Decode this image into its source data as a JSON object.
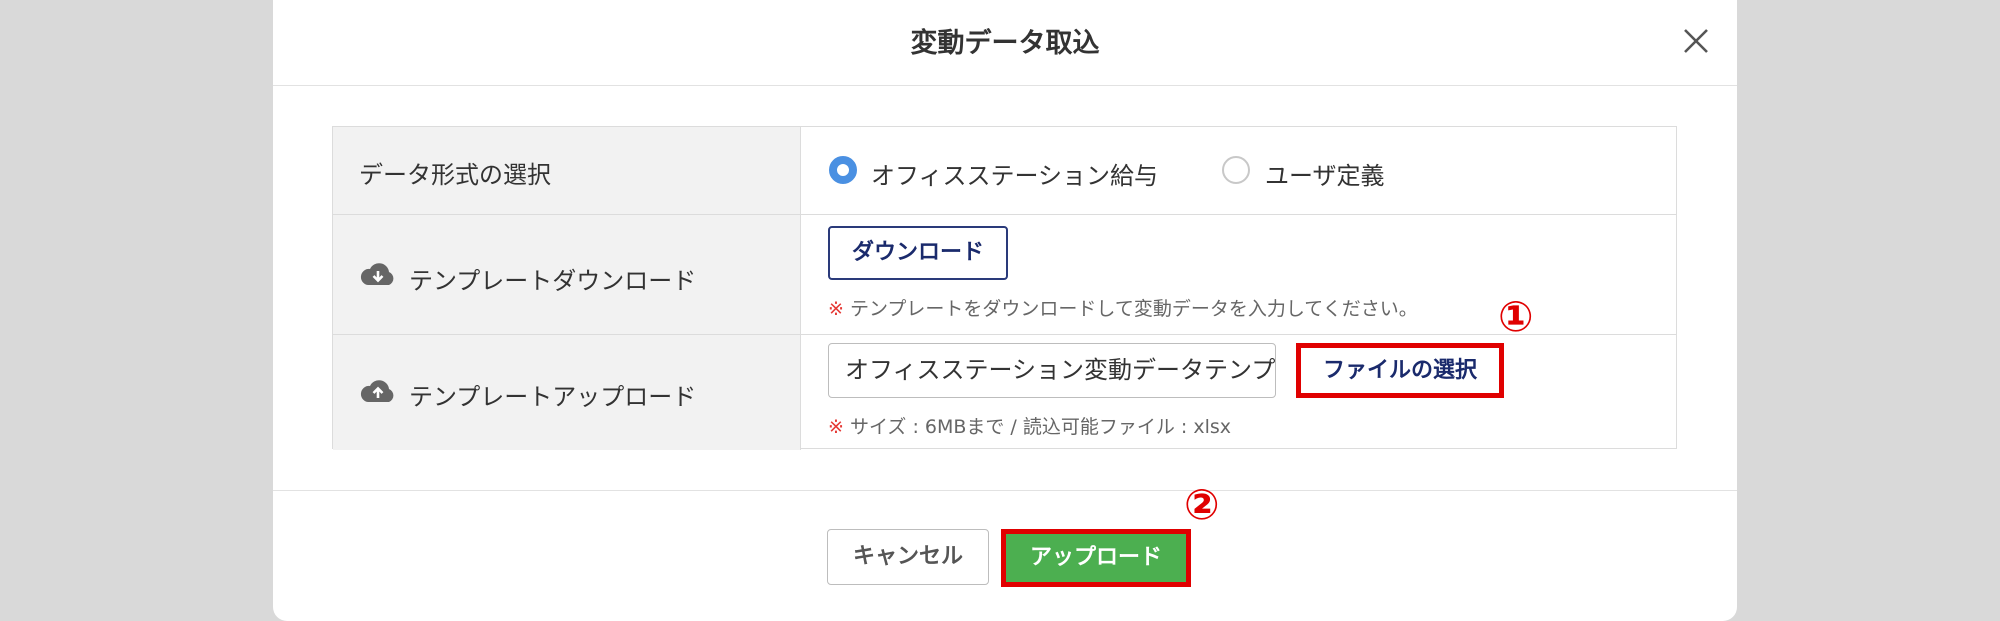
{
  "dialog": {
    "title": "変動データ取込"
  },
  "rows": {
    "format": {
      "label": "データ形式の選択",
      "options": [
        {
          "label": "オフィスステーション給与",
          "checked": true
        },
        {
          "label": "ユーザ定義",
          "checked": false
        }
      ]
    },
    "download": {
      "label": "テンプレートダウンロード",
      "button": "ダウンロード",
      "note_mark": "※",
      "note": "テンプレートをダウンロードして変動データを入力してください。"
    },
    "upload": {
      "label": "テンプレートアップロード",
      "file_value": "オフィスステーション変動データテンプレート",
      "file_button": "ファイルの選択",
      "note_mark": "※",
      "note": "サイズ : 6MBまで / 読込可能ファイル : xlsx"
    }
  },
  "footer": {
    "cancel": "キャンセル",
    "upload": "アップロード"
  },
  "annotations": {
    "step1": "①",
    "step2": "②"
  },
  "colors": {
    "accent_blue": "#4a90e2",
    "upload_green": "#4caf50",
    "highlight_red": "#e00000",
    "button_navy": "#1a2a6c"
  }
}
